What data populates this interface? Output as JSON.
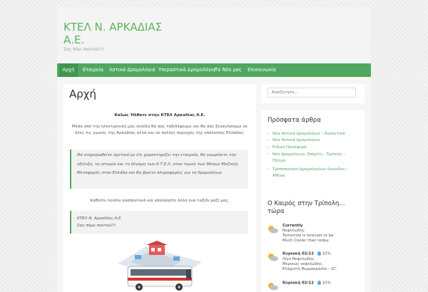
{
  "site": {
    "title": "ΚΤΕΛ Ν. ΑΡΚΑΔΙΑΣ Α.Ε.",
    "description": "Σας πάει παντού!!!"
  },
  "nav": {
    "items": [
      {
        "label": "Αρχή"
      },
      {
        "label": "Εταιρεία"
      },
      {
        "label": "Αστικά Δρομολόγια"
      },
      {
        "label": "Υπεραστικά Δρομολόγια"
      },
      {
        "label": "Τα Νέα μας"
      },
      {
        "label": "Επικοινωνία"
      }
    ]
  },
  "main": {
    "title": "Αρχή",
    "welcome": "Καλώς Ήλθατε στην ΚΤΕΛ Αρκαδίας Α.Ε.",
    "intro": "Μέσα από την ηλεκτρονική μας σελίδα θα σας ταξιδέψουμε και θα σας ξεναγήσουμε σε όλες τις γωνιές της Αρκαδίας αλλά και σε πολλές περιοχές της υπόλοιπης Ελλάδας.",
    "quote1": "Θα ενημερωθείτε σχετικά με ότι χαρακτηρίζει την εταιρεία, θα γνωρίσετε την εξέλιξη, τη ιστορία και τη δύναμη των Κ.Τ.Ε.Λ. στον τομέα των Μέσων Μαζικής Μεταφοράς στην Ελλάδα και θα βρείτε πληροφορίες για τα δρομολόγια.",
    "invite": "Καθίστε λοιπόν αναπαυτικά και απολαύστε άλλο ένα ταξίδι μαζί μας.",
    "quote2_line1": "ΚΤΕΛ Ν. Αρκαδίας Α.Ε.",
    "quote2_line2": "Σας πάμε παντού!!!"
  },
  "sidebar": {
    "search_placeholder": "Αναζήτηση...",
    "recent_title": "Πρόσφατα άρθρα",
    "recent_posts": [
      {
        "label": "Νέα Αστικά Δρομολόγια – Αναλυτικά"
      },
      {
        "label": "Νέα Αστικά Δρομολόγια"
      },
      {
        "label": "Ειδική Προσφορά"
      },
      {
        "label": "Νέο Δρομολόγιο: Σπάρτη – Τρίπολη – Πάτρα"
      },
      {
        "label": "Τροποποίηση Δρομολογίων Λεωνίδιο – Αθήνα"
      }
    ],
    "weather_title": "Ο Καιρός στην Τρίπολη... τώρα",
    "weather": [
      {
        "head": "Currently",
        "line1": "Νεφελώδης",
        "line2": "Tomorrow is forecast to be",
        "line3": "Much Cooler than today."
      },
      {
        "head": "Κυριακή 02/12",
        "rain": "10%",
        "line1": "Λίγο Νεφελώδης",
        "line2": "Μερικώς νεφελώδης.",
        "line3": "Ελάχιστη θερμοκρασία - 1C."
      },
      {
        "head": "Κυριακή 02/12",
        "rain": "10%"
      }
    ]
  },
  "colors": {
    "accent": "#50a860",
    "title_green": "#5cb55c"
  }
}
